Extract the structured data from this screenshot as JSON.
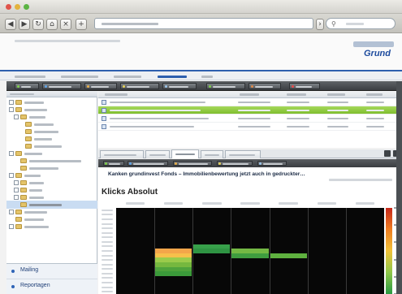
{
  "header": {
    "logo_text": "Grund"
  },
  "report": {
    "title": "Kanken grundinvest Fonds – Immobilienbewertung jetzt auch in gedruckter…",
    "heading": "Klicks Absolut"
  },
  "left_panel": {
    "bottom_items": [
      "Mailing",
      "Reportagen"
    ]
  },
  "heatmap": {
    "columns": 7,
    "rows": 19,
    "scale_colors": [
      "#c6281c",
      "#ee7d21",
      "#f0c23a",
      "#8fc74a",
      "#2a9a44"
    ],
    "visible_cells": [
      {
        "col": 1,
        "row": 9,
        "color": "#f3a64a"
      },
      {
        "col": 1,
        "row": 10,
        "color": "#f6c04b"
      },
      {
        "col": 1,
        "row": 11,
        "color": "#9acb4b"
      },
      {
        "col": 1,
        "row": 12,
        "color": "#76b83f"
      },
      {
        "col": 1,
        "row": 13,
        "color": "#4ea33c"
      },
      {
        "col": 1,
        "row": 14,
        "color": "#3b9a3a"
      },
      {
        "col": 2,
        "row": 8,
        "color": "#37a04a"
      },
      {
        "col": 2,
        "row": 9,
        "color": "#2f9443"
      },
      {
        "col": 3,
        "row": 9,
        "color": "#74b944"
      },
      {
        "col": 3,
        "row": 10,
        "color": "#3f9d3f"
      },
      {
        "col": 4,
        "row": 10,
        "color": "#5fb13f"
      }
    ]
  }
}
